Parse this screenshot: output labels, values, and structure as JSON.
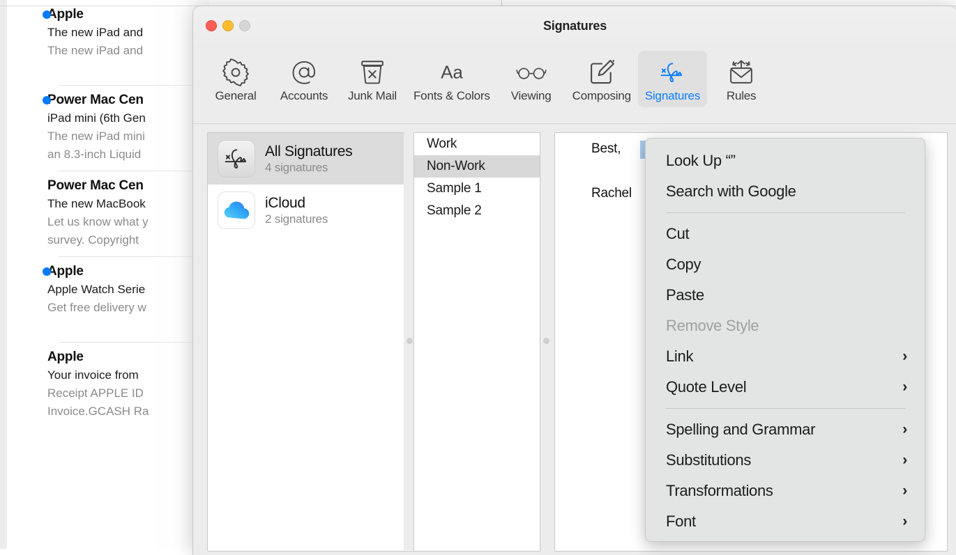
{
  "mail_list": {
    "messages": [
      {
        "sender": "Apple",
        "subject": "The new iPad and",
        "preview1": "The new iPad and",
        "preview2": "",
        "unread": true
      },
      {
        "sender": "Power Mac Cen",
        "subject": "iPad mini (6th Gen",
        "preview1": "The new iPad mini",
        "preview2": "an 8.3-inch Liquid",
        "unread": true
      },
      {
        "sender": "Power Mac Cen",
        "subject": "The new MacBook",
        "preview1": "Let us know what y",
        "preview2": "survey. Copyright",
        "unread": false
      },
      {
        "sender": "Apple",
        "subject": "Apple Watch Serie",
        "preview1": "Get free delivery w",
        "preview2": "",
        "unread": true
      },
      {
        "sender": "Apple",
        "subject": "Your invoice from",
        "preview1": "Receipt   APPLE ID",
        "preview2": "Invoice.GCASH Ra",
        "unread": false
      }
    ],
    "unread_dot_color": "#007aff"
  },
  "window": {
    "title": "Signatures",
    "traffic_lights": {
      "close": "close-button",
      "minimize": "minimize-button",
      "zoom": "zoom-button"
    }
  },
  "toolbar": {
    "active_tab": "Signatures",
    "accent_color": "#0a7cff",
    "items": [
      {
        "label": "General",
        "icon": "gear-icon"
      },
      {
        "label": "Accounts",
        "icon": "at-sign-icon"
      },
      {
        "label": "Junk Mail",
        "icon": "junk-bin-icon"
      },
      {
        "label": "Fonts & Colors",
        "icon": "aa-icon"
      },
      {
        "label": "Viewing",
        "icon": "glasses-icon"
      },
      {
        "label": "Composing",
        "icon": "compose-pencil-icon"
      },
      {
        "label": "Signatures",
        "icon": "signature-icon"
      },
      {
        "label": "Rules",
        "icon": "rules-envelope-icon"
      }
    ]
  },
  "sources": {
    "items": [
      {
        "title": "All Signatures",
        "subtitle": "4 signatures",
        "icon": "signature-icon",
        "selected": true
      },
      {
        "title": "iCloud",
        "subtitle": "2 signatures",
        "icon": "icloud-icon",
        "selected": false
      }
    ]
  },
  "signature_list": {
    "items": [
      {
        "label": "Work",
        "selected": false
      },
      {
        "label": "Non-Work",
        "selected": true
      },
      {
        "label": "Sample 1",
        "selected": false
      },
      {
        "label": "Sample 2",
        "selected": false
      }
    ]
  },
  "editor": {
    "line1": "Best,",
    "line2": "Rachel",
    "selection_color": "#a8cbee"
  },
  "context_menu": {
    "items": [
      {
        "label": "Look Up “”",
        "submenu": false,
        "disabled": false,
        "separator_after": false
      },
      {
        "label": "Search with Google",
        "submenu": false,
        "disabled": false,
        "separator_after": true
      },
      {
        "label": "Cut",
        "submenu": false,
        "disabled": false,
        "separator_after": false
      },
      {
        "label": "Copy",
        "submenu": false,
        "disabled": false,
        "separator_after": false
      },
      {
        "label": "Paste",
        "submenu": false,
        "disabled": false,
        "separator_after": false
      },
      {
        "label": "Remove Style",
        "submenu": false,
        "disabled": true,
        "separator_after": false
      },
      {
        "label": "Link",
        "submenu": true,
        "disabled": false,
        "separator_after": false
      },
      {
        "label": "Quote Level",
        "submenu": true,
        "disabled": false,
        "separator_after": true
      },
      {
        "label": "Spelling and Grammar",
        "submenu": true,
        "disabled": false,
        "separator_after": false
      },
      {
        "label": "Substitutions",
        "submenu": true,
        "disabled": false,
        "separator_after": false
      },
      {
        "label": "Transformations",
        "submenu": true,
        "disabled": false,
        "separator_after": false
      },
      {
        "label": "Font",
        "submenu": true,
        "disabled": false,
        "separator_after": false
      }
    ],
    "submenu_arrow": "chevron-right-icon"
  }
}
